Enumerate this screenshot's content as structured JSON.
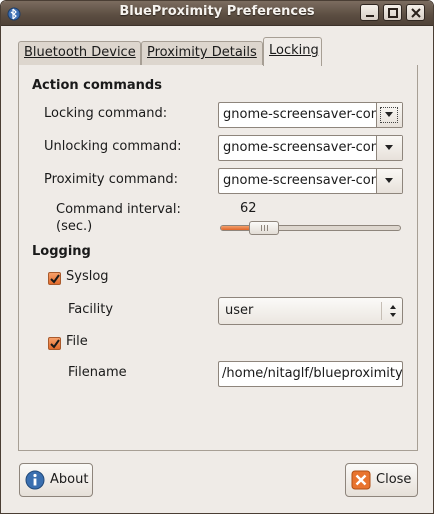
{
  "window": {
    "title": "BlueProximity Preferences",
    "accent": "#e36b2c",
    "controls": {
      "minimize": "minimize-icon",
      "maximize": "maximize-icon",
      "close": "close-icon"
    }
  },
  "tabs": [
    {
      "label": "Bluetooth Device",
      "selected": false
    },
    {
      "label": "Proximity Details",
      "selected": false
    },
    {
      "label": "Locking",
      "selected": true
    }
  ],
  "action_commands": {
    "heading": "Action commands",
    "locking": {
      "label": "Locking command:",
      "value": "gnome-screensaver-command -l"
    },
    "unlocking": {
      "label": "Unlocking command:",
      "value": "gnome-screensaver-command -d"
    },
    "proximity": {
      "label": "Proximity command:",
      "value": "gnome-screensaver-command -p"
    },
    "interval": {
      "label_line1": "Command interval:",
      "label_line2": "(sec.)",
      "value": "62",
      "fraction": 0.1
    }
  },
  "logging": {
    "heading": "Logging",
    "syslog": {
      "label": "Syslog",
      "checked": true
    },
    "facility": {
      "label": "Facility",
      "value": "user"
    },
    "file": {
      "label": "File",
      "checked": true
    },
    "filename": {
      "label": "Filename",
      "value": "/home/nitaglf/blueproximity"
    }
  },
  "buttons": {
    "about": "About",
    "close": "Close"
  }
}
